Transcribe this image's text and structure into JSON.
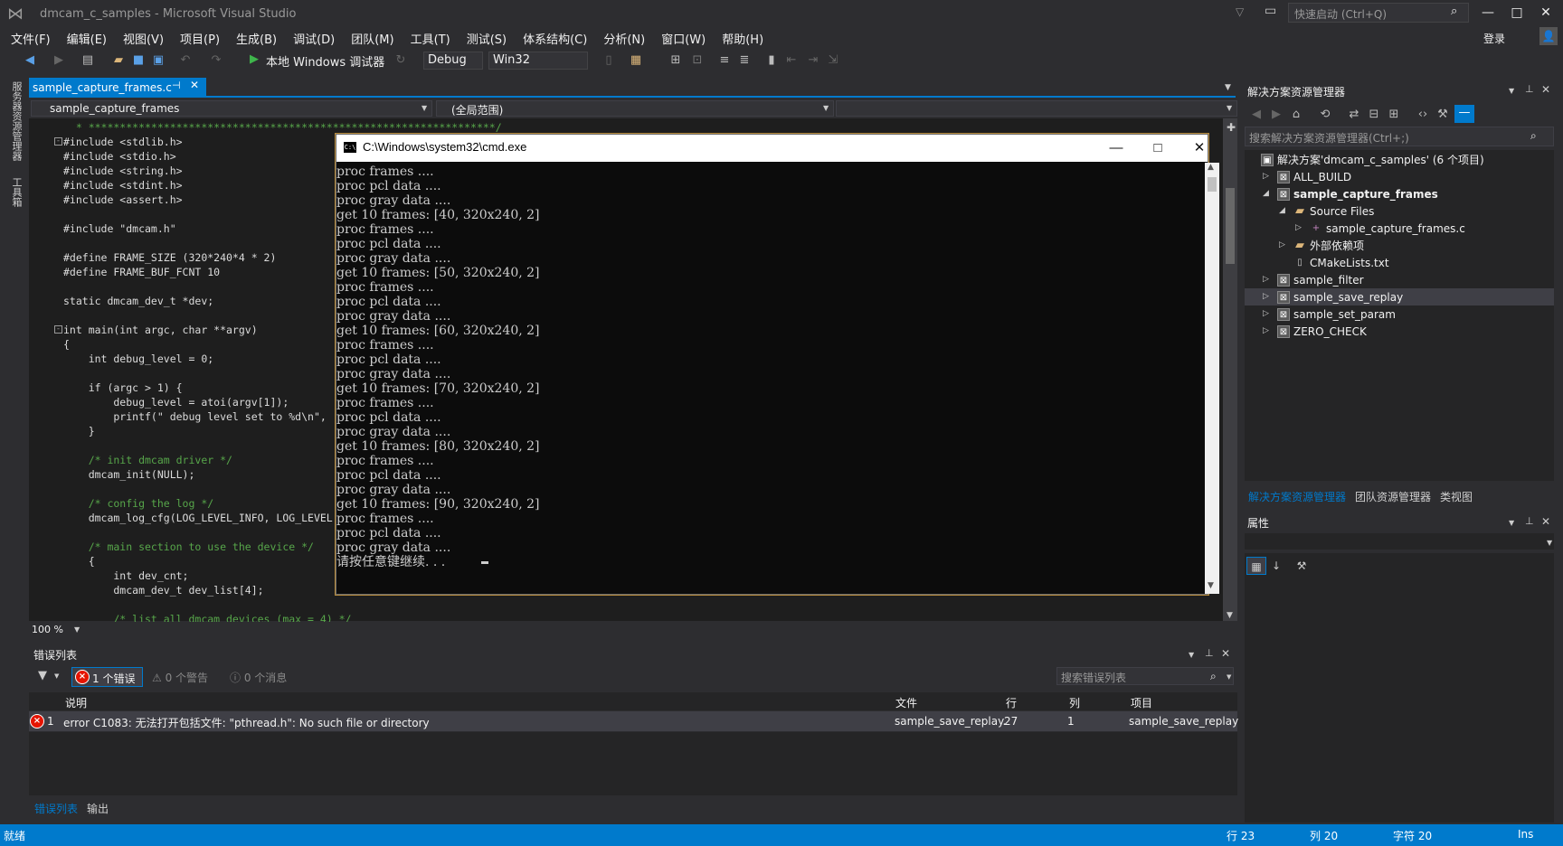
{
  "app": {
    "title": "dmcam_c_samples - Microsoft Visual Studio",
    "quick_launch_placeholder": "快速启动 (Ctrl+Q)",
    "sign_in": "登录"
  },
  "menu": [
    "文件(F)",
    "编辑(E)",
    "视图(V)",
    "项目(P)",
    "生成(B)",
    "调试(D)",
    "团队(M)",
    "工具(T)",
    "测试(S)",
    "体系结构(C)",
    "分析(N)",
    "窗口(W)",
    "帮助(H)"
  ],
  "toolbar": {
    "debug_target": "本地 Windows 调试器",
    "configuration": "Debug",
    "platform": "Win32"
  },
  "left_strip": [
    "服务器资源管理器",
    "工具箱"
  ],
  "editor": {
    "tab_label": "sample_capture_frames.c",
    "nav_file": "sample_capture_frames",
    "nav_scope": "(全局范围)",
    "zoom": "100 %",
    "lines": [
      {
        "t": "  * *****************************************************************/",
        "c": "cm"
      },
      {
        "t": "#include <stdlib.h>",
        "c": ""
      },
      {
        "t": "#include <stdio.h>",
        "c": ""
      },
      {
        "t": "#include <string.h>",
        "c": ""
      },
      {
        "t": "#include <stdint.h>",
        "c": ""
      },
      {
        "t": "#include <assert.h>",
        "c": ""
      },
      {
        "t": "",
        "c": ""
      },
      {
        "t": "#include \"dmcam.h\"",
        "c": ""
      },
      {
        "t": "",
        "c": ""
      },
      {
        "t": "#define FRAME_SIZE (320*240*4 * 2)",
        "c": ""
      },
      {
        "t": "#define FRAME_BUF_FCNT 10",
        "c": ""
      },
      {
        "t": "",
        "c": ""
      },
      {
        "t": "static dmcam_dev_t *dev;",
        "c": ""
      },
      {
        "t": "",
        "c": ""
      },
      {
        "t": "int main(int argc, char **argv)",
        "c": ""
      },
      {
        "t": "{",
        "c": ""
      },
      {
        "t": "    int debug_level = 0;",
        "c": ""
      },
      {
        "t": "",
        "c": ""
      },
      {
        "t": "    if (argc > 1) {",
        "c": ""
      },
      {
        "t": "        debug_level = atoi(argv[1]);",
        "c": ""
      },
      {
        "t": "        printf(\" debug level set to %d\\n\",",
        "c": ""
      },
      {
        "t": "    }",
        "c": ""
      },
      {
        "t": "",
        "c": ""
      },
      {
        "t": "    /* init dmcam driver */",
        "c": "cm"
      },
      {
        "t": "    dmcam_init(NULL);",
        "c": ""
      },
      {
        "t": "",
        "c": ""
      },
      {
        "t": "    /* config the log */",
        "c": "cm"
      },
      {
        "t": "    dmcam_log_cfg(LOG_LEVEL_INFO, LOG_LEVEL",
        "c": ""
      },
      {
        "t": "",
        "c": ""
      },
      {
        "t": "    /* main section to use the device */",
        "c": "cm"
      },
      {
        "t": "    {",
        "c": ""
      },
      {
        "t": "        int dev_cnt;",
        "c": ""
      },
      {
        "t": "        dmcam_dev_t dev_list[4];",
        "c": ""
      },
      {
        "t": "",
        "c": ""
      },
      {
        "t": "        /* list all dmcam devices (max = 4) */",
        "c": "cm"
      }
    ]
  },
  "console": {
    "title": "C:\\Windows\\system32\\cmd.exe",
    "lines": [
      "proc frames ....",
      "proc pcl data ....",
      "proc gray data ....",
      "get 10 frames: [40, 320x240, 2]",
      "proc frames ....",
      "proc pcl data ....",
      "proc gray data ....",
      "get 10 frames: [50, 320x240, 2]",
      "proc frames ....",
      "proc pcl data ....",
      "proc gray data ....",
      "get 10 frames: [60, 320x240, 2]",
      "proc frames ....",
      "proc pcl data ....",
      "proc gray data ....",
      "get 10 frames: [70, 320x240, 2]",
      "proc frames ....",
      "proc pcl data ....",
      "proc gray data ....",
      "get 10 frames: [80, 320x240, 2]",
      "proc frames ....",
      "proc pcl data ....",
      "proc gray data ....",
      "get 10 frames: [90, 320x240, 2]",
      "proc frames ....",
      "proc pcl data ....",
      "proc gray data ....",
      "请按任意键继续. . ."
    ]
  },
  "solution_explorer": {
    "title": "解决方案资源管理器",
    "search_placeholder": "搜索解决方案资源管理器(Ctrl+;)",
    "tree": [
      {
        "label": "解决方案'dmcam_c_samples' (6 个项目)",
        "level": 0,
        "arrow": "",
        "icon": "solution",
        "bold": false
      },
      {
        "label": "ALL_BUILD",
        "level": 1,
        "arrow": "▷",
        "icon": "project",
        "bold": false
      },
      {
        "label": "sample_capture_frames",
        "level": 1,
        "arrow": "◢",
        "icon": "project",
        "bold": true
      },
      {
        "label": "Source Files",
        "level": 2,
        "arrow": "◢",
        "icon": "folder",
        "bold": false
      },
      {
        "label": "sample_capture_frames.c",
        "level": 3,
        "arrow": "▷",
        "icon": "cfile",
        "bold": false
      },
      {
        "label": "外部依赖项",
        "level": 2,
        "arrow": "▷",
        "icon": "folder",
        "bold": false
      },
      {
        "label": "CMakeLists.txt",
        "level": 2,
        "arrow": "",
        "icon": "file",
        "bold": false
      },
      {
        "label": "sample_filter",
        "level": 1,
        "arrow": "▷",
        "icon": "project",
        "bold": false
      },
      {
        "label": "sample_save_replay",
        "level": 1,
        "arrow": "▷",
        "icon": "project",
        "bold": false
      },
      {
        "label": "sample_set_param",
        "level": 1,
        "arrow": "▷",
        "icon": "project",
        "bold": false
      },
      {
        "label": "ZERO_CHECK",
        "level": 1,
        "arrow": "▷",
        "icon": "project",
        "bold": false
      }
    ],
    "tabs": [
      "解决方案资源管理器",
      "团队资源管理器",
      "类视图"
    ]
  },
  "properties": {
    "title": "属性"
  },
  "error_list": {
    "title": "错误列表",
    "errors_btn": "1 个错误",
    "warnings_btn": "0 个警告",
    "messages_btn": "0 个消息",
    "search_placeholder": "搜索错误列表",
    "columns": [
      "说明",
      "文件",
      "行",
      "列",
      "项目"
    ],
    "rows": [
      {
        "num": "1",
        "desc": "error C1083: 无法打开包括文件: \"pthread.h\": No such file or directory",
        "file": "sample_save_replay.",
        "line": "27",
        "col": "1",
        "project": "sample_save_replay"
      }
    ],
    "tabs": [
      "错误列表",
      "输出"
    ]
  },
  "status": {
    "ready": "就绪",
    "line": "行 23",
    "col": "列 20",
    "char": "字符 20",
    "mode": "Ins"
  },
  "colors": {
    "accent": "#007acc",
    "background": "#2d2d30",
    "editor_bg": "#1e1e1e",
    "error_red": "#e51400"
  }
}
